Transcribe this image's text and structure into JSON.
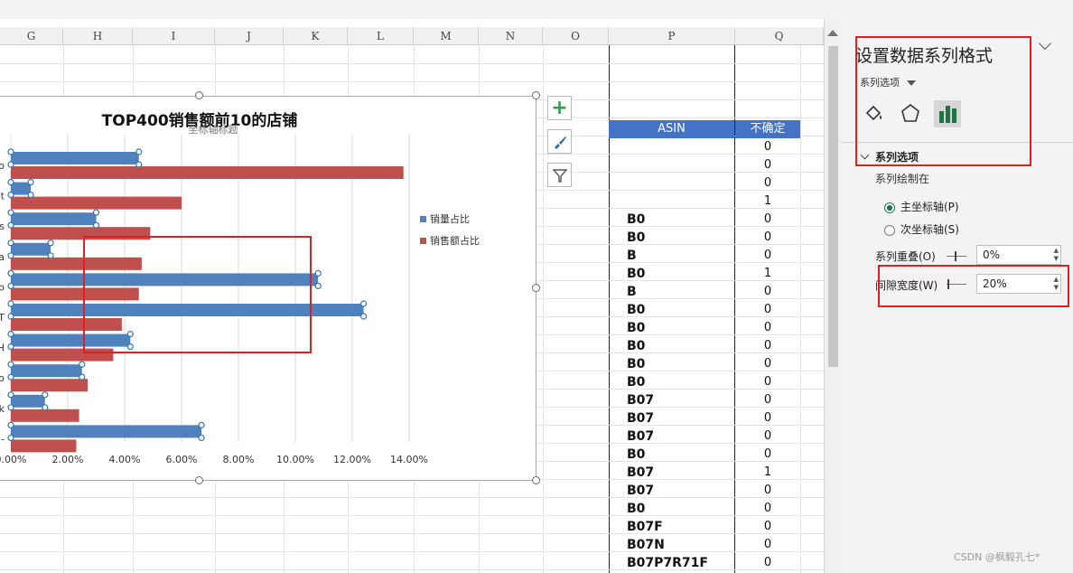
{
  "columns": [
    "G",
    "H",
    "I",
    "J",
    "K",
    "L",
    "M",
    "N",
    "O",
    "P",
    "Q"
  ],
  "chart_data": {
    "type": "bar",
    "title": "TOP400销售额前10的店铺",
    "axis_title_placeholder": "坐标轴标题",
    "categories": [
      "o",
      "t",
      "s",
      "a",
      "o",
      "T",
      "H",
      "o",
      "k",
      "-"
    ],
    "series": [
      {
        "name": "销量占比",
        "values": [
          4.5,
          0.7,
          3.0,
          1.4,
          10.8,
          12.4,
          4.2,
          2.5,
          1.2,
          6.7
        ]
      },
      {
        "name": "销售额占比",
        "values": [
          13.8,
          6.0,
          4.9,
          4.6,
          4.5,
          3.9,
          3.6,
          2.7,
          2.4,
          2.3
        ]
      }
    ],
    "xticks": [
      "0.00%",
      "2.00%",
      "4.00%",
      "6.00%",
      "8.00%",
      "10.00%",
      "12.00%",
      "14.00%"
    ],
    "xlim": [
      0,
      14
    ],
    "legend_position": "right",
    "colors": {
      "series1": "#4f81bd",
      "series2": "#c0504d"
    }
  },
  "table": {
    "header_p": "ASIN",
    "header_q": "不确定",
    "rows": [
      {
        "p": "",
        "q": "0"
      },
      {
        "p": "",
        "q": "0"
      },
      {
        "p": "",
        "q": "0"
      },
      {
        "p": "",
        "q": "1"
      },
      {
        "p": "B0",
        "q": "0"
      },
      {
        "p": "B0",
        "q": "0"
      },
      {
        "p": "B",
        "q": "0"
      },
      {
        "p": "B0",
        "q": "1"
      },
      {
        "p": "B",
        "q": "0"
      },
      {
        "p": "B0",
        "q": "0"
      },
      {
        "p": "B0",
        "q": "0"
      },
      {
        "p": "B0",
        "q": "0"
      },
      {
        "p": "B0",
        "q": "0"
      },
      {
        "p": "B0",
        "q": "0"
      },
      {
        "p": "B07",
        "q": "0"
      },
      {
        "p": "B07",
        "q": "0"
      },
      {
        "p": "B07",
        "q": "0"
      },
      {
        "p": "B0",
        "q": "0"
      },
      {
        "p": "B07",
        "q": "1"
      },
      {
        "p": "B07",
        "q": "0"
      },
      {
        "p": "B0",
        "q": "0"
      },
      {
        "p": "B07F",
        "q": "0"
      },
      {
        "p": "B07N",
        "q": "0"
      },
      {
        "p": "B07P7R71F",
        "q": "0"
      }
    ]
  },
  "pane": {
    "title": "设置数据系列格式",
    "options_dropdown": "系列选项",
    "section_title": "系列选项",
    "plot_on_label": "系列绘制在",
    "primary_axis": "主坐标轴(P)",
    "secondary_axis": "次坐标轴(S)",
    "overlap_label": "系列重叠(O)",
    "overlap_value": "0%",
    "gap_label": "间隙宽度(W)",
    "gap_value": "20%"
  },
  "watermark": "CSDN @枫毅孔七*"
}
